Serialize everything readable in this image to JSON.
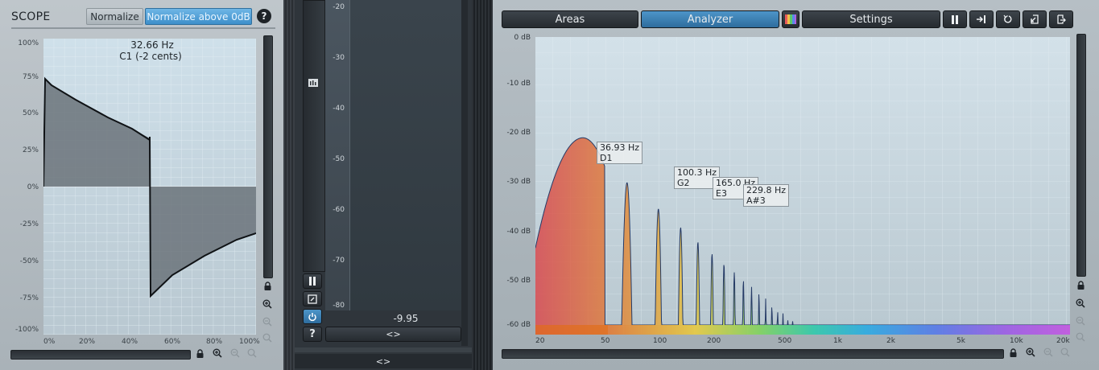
{
  "scope": {
    "title": "SCOPE",
    "normalize_label": "Normalize",
    "normalize_above_label": "Normalize above 0dB",
    "help": "?",
    "freq_readout": "32.66 Hz",
    "note_readout": "C1 (-2 cents)",
    "y_ticks": [
      "100%",
      "75%",
      "50%",
      "25%",
      "0%",
      "-25%",
      "-50%",
      "-75%",
      "-100%"
    ],
    "x_ticks": [
      "0%",
      "20%",
      "40%",
      "60%",
      "80%",
      "100%"
    ]
  },
  "meter": {
    "ticks": [
      "-20",
      "-30",
      "-40",
      "-50",
      "-60",
      "-70",
      "-80"
    ],
    "value": "-9.95",
    "expand_label": "<>",
    "bottom_expand_label": "<>",
    "help": "?"
  },
  "analyzer": {
    "tabs": {
      "areas": "Areas",
      "analyzer": "Analyzer",
      "settings": "Settings"
    },
    "y_ticks": [
      "0 dB",
      "-10 dB",
      "-20 dB",
      "-30 dB",
      "-40 dB",
      "-50 dB",
      "-60 dB"
    ],
    "x_ticks": [
      "20",
      "50",
      "100",
      "200",
      "500",
      "1k",
      "2k",
      "5k",
      "10k",
      "20k"
    ],
    "peaks": [
      {
        "freq": "36.93 Hz",
        "note": "D1"
      },
      {
        "freq": "100.3 Hz",
        "note": "G2"
      },
      {
        "freq": "165.0 Hz",
        "note": "E3"
      },
      {
        "freq": "229.8 Hz",
        "note": "A#3"
      }
    ]
  },
  "colors": {
    "accent": "#3d8fca",
    "scope_bg": "#c4d6e1",
    "analyzer_bg": "#c9d9e2"
  }
}
